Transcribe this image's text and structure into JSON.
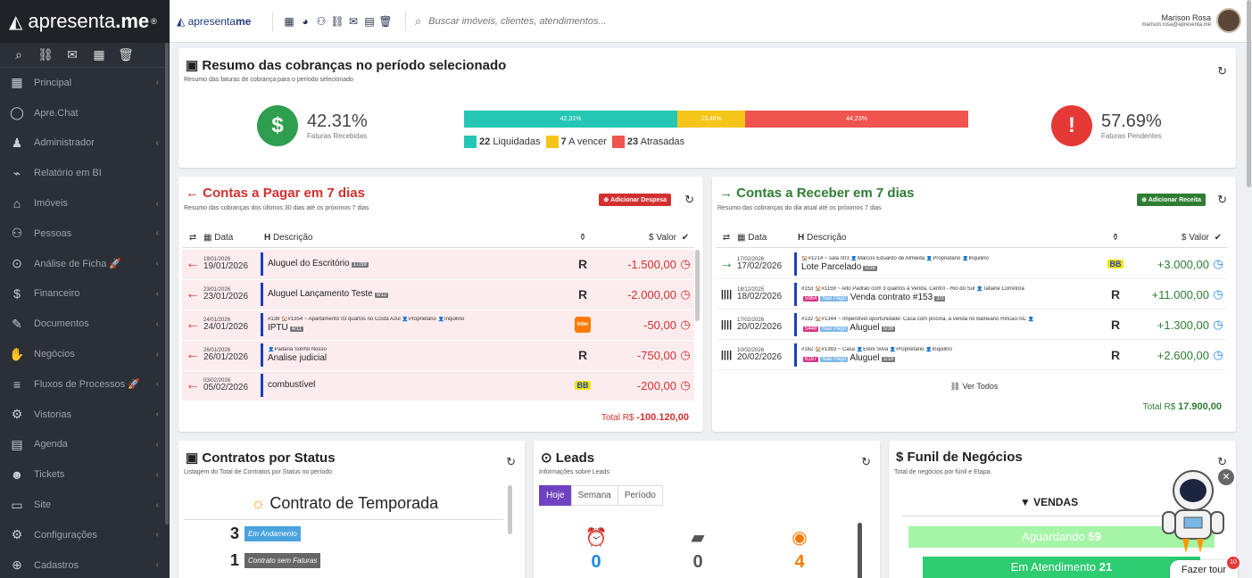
{
  "sidebar": {
    "brand_prefix": "apresenta",
    "brand_suffix": ".me",
    "brand_mark": "®",
    "quick_icons": [
      "search-icon",
      "link-icon",
      "mail-icon",
      "calendar-icon",
      "trash-icon"
    ],
    "items": [
      {
        "label": "Principal",
        "icon": "▦"
      },
      {
        "label": "Apre.Chat",
        "icon": "◯"
      },
      {
        "label": "Administrador",
        "icon": "♟"
      },
      {
        "label": "Relatório em BI",
        "icon": "⌁"
      },
      {
        "label": "Imóveis",
        "icon": "⌂"
      },
      {
        "label": "Pessoas",
        "icon": "⚇"
      },
      {
        "label": "Análise de Ficha 🚀",
        "icon": "⊙"
      },
      {
        "label": "Financeiro",
        "icon": "$"
      },
      {
        "label": "Documentos",
        "icon": "✎"
      },
      {
        "label": "Negócios",
        "icon": "✋"
      },
      {
        "label": "Fluxos de Processos 🚀",
        "icon": "≡"
      },
      {
        "label": "Vistorias",
        "icon": "⚙"
      },
      {
        "label": "Agenda",
        "icon": "▤"
      },
      {
        "label": "Tickets",
        "icon": "☻"
      },
      {
        "label": "Site",
        "icon": "▭"
      },
      {
        "label": "Configurações",
        "icon": "⚙"
      },
      {
        "label": "Cadastros",
        "icon": "⊕"
      }
    ]
  },
  "topbar": {
    "logo_prefix": "apresenta",
    "logo_suffix": "me",
    "search_placeholder": "Buscar imóveis, clientes, atendimentos...",
    "user_name": "Marison Rosa",
    "user_email": "marison.rosa@apresenta.me"
  },
  "summary": {
    "title": "Resumo das cobranças no período selecionado",
    "subtitle": "Resumo das faturas de cobrança para o período selecionado",
    "received_pct": "42.31%",
    "received_label": "Faturas Recebidas",
    "pending_pct": "57.69%",
    "pending_label": "Faturas Pendentes",
    "bar": [
      {
        "label": "42,31%",
        "value": 42.31,
        "color": "#26c6b5"
      },
      {
        "label": "13,46%",
        "value": 13.46,
        "color": "#f5c518"
      },
      {
        "label": "44,23%",
        "value": 44.23,
        "color": "#f0544f"
      }
    ],
    "legend": [
      {
        "count": "22",
        "label": "Liquidadas",
        "color": "#26c6b5"
      },
      {
        "count": "7",
        "label": "A vencer",
        "color": "#f5c518"
      },
      {
        "count": "23",
        "label": "Atrasadas",
        "color": "#f0544f"
      }
    ]
  },
  "payables": {
    "title_prefix": "← Contas a ",
    "title_bold": "Pagar",
    "title_suffix": " em 7 dias",
    "subtitle": "Resumo das cobranças dos últimos 30 dias até os próximos 7 dias",
    "add_button": "Adicionar Despesa",
    "col_date": "Data",
    "col_desc": "Descrição",
    "col_value": "Valor",
    "rows": [
      {
        "d1": "19/01/2026",
        "d2": "19/01/2026",
        "small": "",
        "main": "Aluguel do Escritório",
        "tag": "17/39",
        "bank": "R",
        "val": "-1.500,00"
      },
      {
        "d1": "23/01/2026",
        "d2": "23/01/2026",
        "small": "",
        "main": "Aluguel Lançamento Teste",
        "tag": "9/12",
        "bank": "R",
        "val": "-2.000,00"
      },
      {
        "d1": "24/01/2026",
        "d2": "24/01/2026",
        "small": "#138 🏠#1354 ~ Apartamento 03 quartos no Costa Azul 👤Proprietário 👤Inquilino",
        "main": "IPTU",
        "tag": "4/11",
        "bank": "inter",
        "val": "-50,00"
      },
      {
        "d1": "26/01/2026",
        "d2": "26/01/2026",
        "small": "👤Padaria Sonho Nosso",
        "main": "Analise judicial",
        "tag": "",
        "bank": "R",
        "val": "-750,00"
      },
      {
        "d1": "03/02/2026",
        "d2": "05/02/2026",
        "small": "",
        "main": "combustível",
        "tag": "",
        "bank": "BB",
        "val": "-200,00"
      }
    ],
    "total_label": "Total R$",
    "total_value": "-100.120,00"
  },
  "receivables": {
    "title_prefix": "→ Contas a ",
    "title_bold": "Receber",
    "title_suffix": " em 7 dias",
    "subtitle": "Resumo das cobranças do dia atual até os próximos 7 dias",
    "add_button": "Adicionar Receita",
    "col_date": "Data",
    "col_desc": "Descrição",
    "col_value": "Valor",
    "rows": [
      {
        "d1": "17/02/2026",
        "d2": "17/02/2026",
        "small": "🏠#1214 ~ sala 003 👤Marcos Eduardo de Almeida 👤Proprietário 👤Inquilino",
        "main": "Lote Parcelado",
        "tag": "5/36",
        "tag2": "",
        "tag3": "",
        "bank": "BB",
        "val": "+3.000,00",
        "arrow": "→"
      },
      {
        "d1": "18/12/2025",
        "d2": "18/02/2026",
        "small": "#153 🏠#1159 ~ Alto Padrão com 3 quartos à Venda, Centro - Rio do Sul 👤Tatiane Corretora",
        "main": "Venda contrato #153",
        "tag": "3/3",
        "tag2": "5964",
        "tag3": "Não Pago",
        "bank": "R",
        "val": "+11.000,00",
        "arrow": "||||"
      },
      {
        "d1": "17/02/2026",
        "d2": "20/02/2026",
        "small": "#132 🏠#1344 ~ Imperdível oportunidade: Casa com piscina, à venda no Balneário Rincão-SC 👤",
        "main": "Aluguel",
        "tag": "5/36",
        "tag2": "5448",
        "tag3": "Não Pago",
        "bank": "R",
        "val": "+1.300,00",
        "arrow": "||||"
      },
      {
        "d1": "10/02/2026",
        "d2": "20/02/2026",
        "small": "#162 🏠#1383 ~ Casa 👤Eleni Silva 👤Proprietário 👤Inquilino",
        "main": "Aluguel",
        "tag": "1/18",
        "tag2": "6197",
        "tag3": "Não Pago",
        "bank": "R",
        "val": "+2.600,00",
        "arrow": "||||"
      }
    ],
    "see_all": "Ver Todos",
    "total_label": "Total R$",
    "total_value": "17.900,00"
  },
  "contracts": {
    "title": "Contratos por Status",
    "subtitle": "Listagem do Total de Contratos por Status no período",
    "heading": "Contrato de Temporada",
    "rows": [
      {
        "count": "3",
        "status": "Em Andamento",
        "color": "#4aa3df"
      },
      {
        "count": "1",
        "status": "Contrato sem Faturas",
        "color": "#666666"
      }
    ]
  },
  "leads": {
    "title": "Leads",
    "subtitle": "Informações sobre Leads",
    "tabs": [
      "Hoje",
      "Semana",
      "Período"
    ],
    "stats": [
      {
        "icon": "⏰",
        "value": "0",
        "color": "#1e88e5"
      },
      {
        "icon": "▰",
        "value": "0",
        "color": "#555555"
      },
      {
        "icon": "◉",
        "value": "4",
        "color": "#f57c00"
      }
    ]
  },
  "funnel": {
    "title": "Funil de Negócios",
    "subtitle": "Total de negócios por fúnil e Etapa.",
    "heading": "VENDAS",
    "stages": [
      {
        "label": "Aguardando",
        "count": "59",
        "color": "#a6f5a6"
      },
      {
        "label": "Em Atendimento",
        "count": "21",
        "color": "#2ecc71"
      }
    ],
    "tour_label": "Fazer tour",
    "tour_badge": "10"
  }
}
